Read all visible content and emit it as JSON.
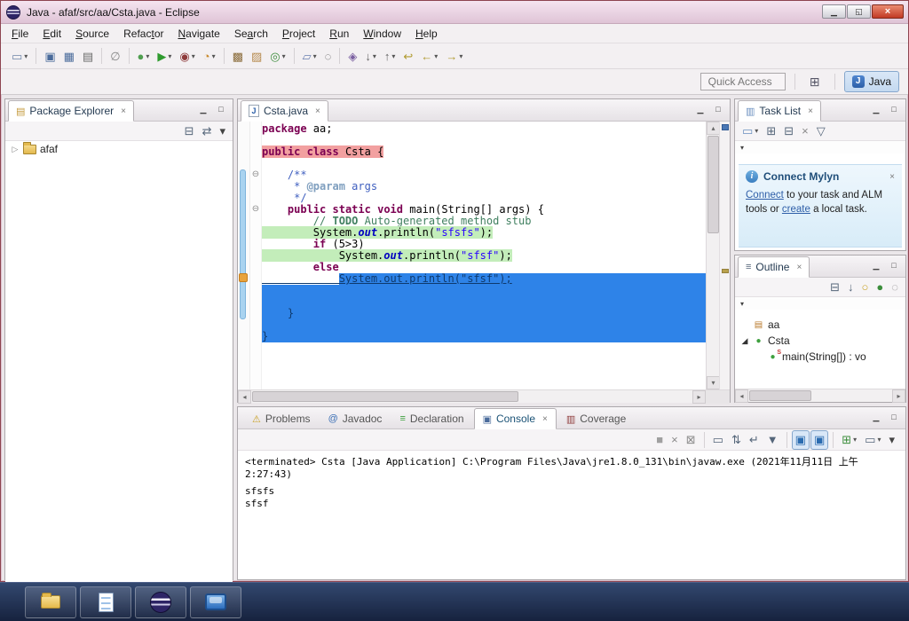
{
  "window": {
    "title": "Java - afaf/src/aa/Csta.java - Eclipse"
  },
  "glyphs": {
    "minimize": "▁",
    "restore": "◱",
    "close": "×",
    "view_minimize": "▁",
    "view_maximize": "□",
    "tab_close": "×",
    "chevron": "▾",
    "expander": "▷",
    "expander_open": "◢",
    "fold": "⊖",
    "up": "▴",
    "down": "▾",
    "left": "◂",
    "right": "▸",
    "java_letter": "J",
    "info_letter": "i",
    "pkg_view_icon": "▤",
    "task_view_icon": "▥",
    "outline_view_icon": "≡",
    "open_perspective_icon": "⊞"
  },
  "menu": {
    "items": [
      {
        "label": "File",
        "u": 0
      },
      {
        "label": "Edit",
        "u": 0
      },
      {
        "label": "Source",
        "u": 0
      },
      {
        "label": "Refactor",
        "u": 5
      },
      {
        "label": "Navigate",
        "u": 0
      },
      {
        "label": "Search",
        "u": 2
      },
      {
        "label": "Project",
        "u": 0
      },
      {
        "label": "Run",
        "u": 0
      },
      {
        "label": "Window",
        "u": 0
      },
      {
        "label": "Help",
        "u": 0
      }
    ]
  },
  "toolbar": {
    "buttons": [
      {
        "name": "new-wizard",
        "glyph": "▭",
        "color": "#6E86A8",
        "drop": true
      },
      {
        "sep": true
      },
      {
        "name": "save",
        "glyph": "▣",
        "color": "#4A6B9B"
      },
      {
        "name": "save-all",
        "glyph": "▦",
        "color": "#4A6B9B"
      },
      {
        "name": "print",
        "glyph": "▤",
        "color": "#6B6B6B"
      },
      {
        "sep": true
      },
      {
        "name": "skip-all-breakpoints",
        "glyph": "∅",
        "color": "#888888"
      },
      {
        "sep": true
      },
      {
        "name": "debug",
        "glyph": "●",
        "color": "#4F9E4F",
        "drop": true
      },
      {
        "name": "run",
        "glyph": "▶",
        "color": "#2F9B2F",
        "drop": true
      },
      {
        "name": "coverage",
        "glyph": "◉",
        "color": "#8E3B3B",
        "drop": true
      },
      {
        "name": "run-external-tools",
        "glyph": "◔",
        "color": "#C8882A",
        "drop": true
      },
      {
        "sep": true
      },
      {
        "name": "new-java-project",
        "glyph": "▩",
        "color": "#8A6B3A"
      },
      {
        "name": "new-java-package",
        "glyph": "▨",
        "color": "#B5884A"
      },
      {
        "name": "new-java-class",
        "glyph": "◎",
        "color": "#3F8E3F",
        "drop": true
      },
      {
        "sep": true
      },
      {
        "name": "open-task",
        "glyph": "▱",
        "color": "#6A7FB0",
        "drop": true
      },
      {
        "name": "search",
        "glyph": "◌",
        "color": "#555555"
      },
      {
        "sep": true
      },
      {
        "name": "open-type",
        "glyph": "◈",
        "color": "#7A5FA0"
      },
      {
        "name": "next-annotation",
        "glyph": "↓",
        "color": "#666666",
        "drop": true
      },
      {
        "name": "previous-annotation",
        "glyph": "↑",
        "color": "#666666",
        "drop": true
      },
      {
        "name": "last-edit-location",
        "glyph": "↩",
        "color": "#B09A2F"
      },
      {
        "name": "back",
        "glyph": "←",
        "color": "#B09A2F",
        "drop": true
      },
      {
        "name": "forward",
        "glyph": "→",
        "color": "#B09A2F",
        "drop": true
      }
    ]
  },
  "quick_access": {
    "label": "Quick Access"
  },
  "perspective": {
    "java": "Java"
  },
  "package_explorer": {
    "title": "Package Explorer",
    "toolbar": [
      {
        "name": "collapse-all",
        "glyph": "⊟",
        "color": "#55667A"
      },
      {
        "name": "link-with-editor",
        "glyph": "⇄",
        "color": "#55667A"
      },
      {
        "name": "view-menu",
        "glyph": "▾",
        "color": "#444444"
      }
    ],
    "project": "afaf"
  },
  "editor": {
    "tab": "Csta.java",
    "lines": [
      {
        "segs": [
          [
            "kw",
            "package"
          ],
          [
            "pl",
            " aa;"
          ]
        ]
      },
      {
        "segs": []
      },
      {
        "bg": "red",
        "segs": [
          [
            "kw",
            "public"
          ],
          [
            "pl",
            " "
          ],
          [
            "kw",
            "class"
          ],
          [
            "pl",
            " Csta {"
          ]
        ]
      },
      {
        "segs": []
      },
      {
        "fold": true,
        "segs": [
          [
            "doc",
            "    /**"
          ]
        ]
      },
      {
        "segs": [
          [
            "doc",
            "     * "
          ],
          [
            "doctag",
            "@param"
          ],
          [
            "doc",
            " args"
          ]
        ]
      },
      {
        "segs": [
          [
            "doc",
            "     */"
          ]
        ]
      },
      {
        "fold": true,
        "segs": [
          [
            "pl",
            "    "
          ],
          [
            "kw",
            "public"
          ],
          [
            "pl",
            " "
          ],
          [
            "kw",
            "static"
          ],
          [
            "pl",
            " "
          ],
          [
            "kw",
            "void"
          ],
          [
            "pl",
            " main(String[] args) {"
          ]
        ]
      },
      {
        "segs": [
          [
            "pl",
            "        "
          ],
          [
            "cm",
            "// "
          ],
          [
            "todo",
            "TODO"
          ],
          [
            "cm",
            " Auto-generated method stub"
          ]
        ]
      },
      {
        "bg": "green",
        "segs": [
          [
            "pl",
            "        System."
          ],
          [
            "fld",
            "out"
          ],
          [
            "pl",
            ".println("
          ],
          [
            "str",
            "\"sfsfs\""
          ],
          [
            "pl",
            ");"
          ]
        ]
      },
      {
        "segs": [
          [
            "pl",
            "        "
          ],
          [
            "kw",
            "if"
          ],
          [
            "pl",
            " (5>3)"
          ]
        ]
      },
      {
        "bg": "green",
        "segs": [
          [
            "pl",
            "            System."
          ],
          [
            "fld",
            "out"
          ],
          [
            "pl",
            ".println("
          ],
          [
            "str",
            "\"sfsf\""
          ],
          [
            "pl",
            ");"
          ]
        ]
      },
      {
        "segs": [
          [
            "pl",
            "        "
          ],
          [
            "kw",
            "else"
          ]
        ]
      },
      {
        "bg": "sel-first",
        "segs": [
          [
            "sel",
            "            System.out.println(\"sfsf\");"
          ]
        ]
      },
      {
        "bg": "sel",
        "segs": []
      },
      {
        "bg": "sel",
        "segs": []
      },
      {
        "bg": "sel",
        "segs": [
          [
            "sel",
            "    }"
          ]
        ]
      },
      {
        "bg": "sel",
        "segs": []
      },
      {
        "bg": "sel",
        "segs": [
          [
            "sel",
            "}"
          ]
        ]
      }
    ]
  },
  "task_list": {
    "title": "Task List",
    "toolbar": [
      {
        "name": "new-task",
        "glyph": "▭",
        "color": "#6A8FBF",
        "drop": true
      },
      {
        "name": "categorized-presentation",
        "glyph": "⊞",
        "color": "#55667A"
      },
      {
        "name": "scheduled-presentation",
        "glyph": "⊟",
        "color": "#55667A"
      },
      {
        "name": "delete-task",
        "glyph": "×",
        "color": "#8A8A8A"
      },
      {
        "name": "filter-tasks",
        "glyph": "▽",
        "color": "#55667A"
      }
    ],
    "mylyn": {
      "title": "Connect Mylyn",
      "link1": "Connect",
      "text1": " to your task and ALM tools or ",
      "link2": "create",
      "text2": " a local task."
    }
  },
  "outline": {
    "title": "Outline",
    "toolbar": [
      {
        "name": "collapse-all",
        "glyph": "⊟",
        "color": "#55667A"
      },
      {
        "name": "sort",
        "glyph": "↓",
        "color": "#55667A"
      },
      {
        "name": "hide-fields",
        "glyph": "○",
        "color": "#C9A227"
      },
      {
        "name": "hide-static-members",
        "glyph": "●",
        "color": "#3C8E3C"
      },
      {
        "name": "hide-non-public-members",
        "glyph": "◌",
        "color": "#888888"
      }
    ],
    "items": [
      {
        "label": "aa",
        "icon": "package",
        "depth": 0
      },
      {
        "label": "Csta",
        "icon": "class",
        "depth": 0,
        "expanded": true
      },
      {
        "label": "main(String[]) : vo",
        "icon": "static-method",
        "depth": 1
      }
    ]
  },
  "console": {
    "tabs": [
      {
        "label": "Problems",
        "icon": "problems",
        "glyph": "⚠",
        "color": "#C9A227"
      },
      {
        "label": "Javadoc",
        "icon": "javadoc",
        "glyph": "@",
        "color": "#3B6FB5"
      },
      {
        "label": "Declaration",
        "icon": "declaration",
        "glyph": "≡",
        "color": "#3FA03F"
      },
      {
        "label": "Console",
        "icon": "console",
        "glyph": "▣",
        "color": "#4A6B9B"
      },
      {
        "label": "Coverage",
        "icon": "coverage",
        "glyph": "▥",
        "color": "#8E3B3B"
      }
    ],
    "active": "Console",
    "toolbar": [
      {
        "name": "terminate",
        "glyph": "■",
        "color": "#A0A0A0"
      },
      {
        "name": "remove-launch",
        "glyph": "×",
        "color": "#8A8A8A"
      },
      {
        "name": "remove-all-terminated",
        "glyph": "⊠",
        "color": "#8A8A8A"
      },
      {
        "sep": true
      },
      {
        "name": "clear-console",
        "glyph": "▭",
        "color": "#55667A"
      },
      {
        "name": "scroll-lock",
        "glyph": "⇅",
        "color": "#55667A"
      },
      {
        "name": "word-wrap",
        "glyph": "↵",
        "color": "#55667A"
      },
      {
        "name": "pin-console",
        "glyph": "▼",
        "color": "#55667A"
      },
      {
        "sep": true
      },
      {
        "name": "show-console-on-stdout",
        "glyph": "▣",
        "color": "#2B6CB0",
        "pressed": true
      },
      {
        "name": "show-console-on-stderr",
        "glyph": "▣",
        "color": "#2B6CB0",
        "pressed": true
      },
      {
        "sep": true
      },
      {
        "name": "open-console",
        "glyph": "⊞",
        "color": "#3C8E3C",
        "drop": true
      },
      {
        "name": "display-selected-console",
        "glyph": "▭",
        "color": "#55667A",
        "drop": true
      },
      {
        "name": "view-menu",
        "glyph": "▾",
        "color": "#444444"
      }
    ],
    "header": "<terminated> Csta [Java Application] C:\\Program Files\\Java\\jre1.8.0_131\\bin\\javaw.exe (2021年11月11日 上午2:27:43)",
    "output": [
      "sfsfs",
      "sfsf"
    ]
  },
  "taskbar": {
    "buttons": [
      {
        "name": "windows-explorer"
      },
      {
        "name": "text-editor"
      },
      {
        "name": "eclipse"
      },
      {
        "name": "computer"
      }
    ]
  }
}
